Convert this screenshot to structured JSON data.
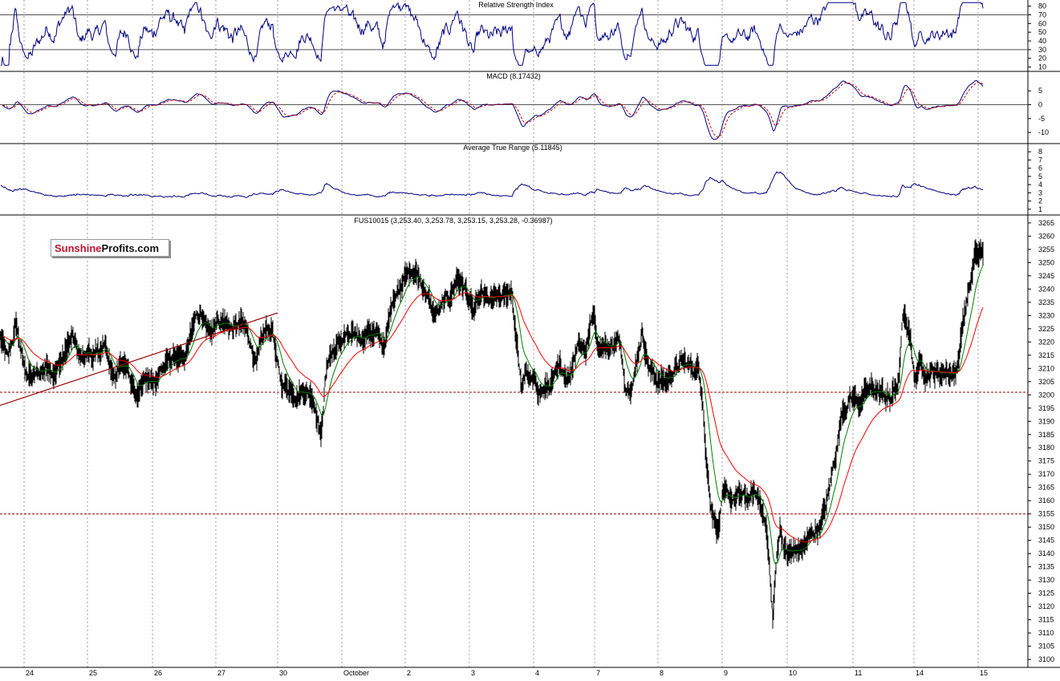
{
  "chart_data": [
    {
      "type": "line",
      "title": "Relative Strength Index",
      "ylim": [
        5,
        87
      ],
      "yticks": [
        10,
        20,
        30,
        40,
        50,
        60,
        70,
        80
      ],
      "reference_lines": [
        70,
        30
      ],
      "series_color": "#000080"
    },
    {
      "type": "line",
      "title": "MACD (8.17432)",
      "ylim": [
        -14,
        12
      ],
      "yticks": [
        -10,
        -5,
        0,
        5
      ],
      "reference_lines": [
        0
      ],
      "series": [
        {
          "color": "#000080",
          "style": "solid"
        },
        {
          "color": "#cc0000",
          "style": "dashed"
        }
      ]
    },
    {
      "type": "line",
      "title": "Average True Range (5.11845)",
      "ylim": [
        0.3,
        9
      ],
      "yticks": [
        1,
        2,
        3,
        4,
        5,
        6,
        7,
        8
      ],
      "series_color": "#000080"
    },
    {
      "type": "line",
      "title": "FUS10015 (3,253.40, 3,253.78, 3,253.15, 3,253.28, -0.36987)",
      "ylim": [
        3097,
        3268
      ],
      "yticks": [
        3100,
        3105,
        3110,
        3115,
        3120,
        3125,
        3130,
        3135,
        3140,
        3145,
        3150,
        3155,
        3160,
        3165,
        3170,
        3175,
        3180,
        3185,
        3190,
        3195,
        3200,
        3205,
        3210,
        3215,
        3220,
        3225,
        3230,
        3235,
        3240,
        3245,
        3250,
        3255,
        3260,
        3265
      ],
      "x_ticks": [
        "24",
        "25",
        "26",
        "27",
        "30",
        "October",
        "2",
        "3",
        "4",
        "7",
        "8",
        "9",
        "10",
        "11",
        "14",
        "15"
      ],
      "price_anchors": [
        [
          0,
          3222
        ],
        [
          10,
          3212
        ],
        [
          20,
          3226
        ],
        [
          30,
          3210
        ],
        [
          40,
          3206
        ],
        [
          50,
          3208
        ],
        [
          60,
          3212
        ],
        [
          70,
          3210
        ],
        [
          80,
          3215
        ],
        [
          90,
          3222
        ],
        [
          100,
          3212
        ],
        [
          110,
          3216
        ],
        [
          120,
          3214
        ],
        [
          130,
          3218
        ],
        [
          140,
          3208
        ],
        [
          150,
          3210
        ],
        [
          160,
          3212
        ],
        [
          170,
          3200
        ],
        [
          180,
          3206
        ],
        [
          190,
          3204
        ],
        [
          200,
          3210
        ],
        [
          210,
          3212
        ],
        [
          220,
          3215
        ],
        [
          230,
          3210
        ],
        [
          240,
          3225
        ],
        [
          250,
          3230
        ],
        [
          260,
          3222
        ],
        [
          270,
          3230
        ],
        [
          280,
          3228
        ],
        [
          290,
          3225
        ],
        [
          300,
          3226
        ],
        [
          310,
          3222
        ],
        [
          320,
          3212
        ],
        [
          330,
          3222
        ],
        [
          340,
          3225
        ],
        [
          345,
          3212
        ],
        [
          350,
          3204
        ],
        [
          360,
          3203
        ],
        [
          370,
          3202
        ],
        [
          380,
          3203
        ],
        [
          390,
          3200
        ],
        [
          397,
          3192
        ],
        [
          400,
          3185
        ],
        [
          405,
          3205
        ],
        [
          410,
          3215
        ],
        [
          420,
          3218
        ],
        [
          430,
          3222
        ],
        [
          440,
          3220
        ],
        [
          450,
          3222
        ],
        [
          460,
          3225
        ],
        [
          470,
          3222
        ],
        [
          480,
          3218
        ],
        [
          490,
          3238
        ],
        [
          500,
          3242
        ],
        [
          505,
          3250
        ],
        [
          510,
          3246
        ],
        [
          520,
          3245
        ],
        [
          530,
          3240
        ],
        [
          540,
          3230
        ],
        [
          550,
          3232
        ],
        [
          560,
          3236
        ],
        [
          570,
          3245
        ],
        [
          580,
          3240
        ],
        [
          590,
          3230
        ],
        [
          600,
          3236
        ],
        [
          610,
          3234
        ],
        [
          620,
          3235
        ],
        [
          630,
          3236
        ],
        [
          638,
          3240
        ],
        [
          642,
          3225
        ],
        [
          645,
          3218
        ],
        [
          650,
          3200
        ],
        [
          655,
          3210
        ],
        [
          660,
          3205
        ],
        [
          670,
          3202
        ],
        [
          680,
          3202
        ],
        [
          690,
          3205
        ],
        [
          700,
          3208
        ],
        [
          710,
          3208
        ],
        [
          720,
          3222
        ],
        [
          730,
          3218
        ],
        [
          740,
          3232
        ],
        [
          745,
          3220
        ],
        [
          750,
          3220
        ],
        [
          760,
          3218
        ],
        [
          770,
          3222
        ],
        [
          780,
          3204
        ],
        [
          790,
          3208
        ],
        [
          800,
          3225
        ],
        [
          810,
          3210
        ],
        [
          820,
          3206
        ],
        [
          830,
          3205
        ],
        [
          840,
          3210
        ],
        [
          850,
          3212
        ],
        [
          860,
          3210
        ],
        [
          870,
          3210
        ],
        [
          876,
          3200
        ],
        [
          880,
          3178
        ],
        [
          885,
          3162
        ],
        [
          890,
          3155
        ],
        [
          895,
          3150
        ],
        [
          900,
          3160
        ],
        [
          910,
          3160
        ],
        [
          920,
          3161
        ],
        [
          930,
          3160
        ],
        [
          940,
          3162
        ],
        [
          950,
          3158
        ],
        [
          955,
          3150
        ],
        [
          960,
          3130
        ],
        [
          963,
          3115
        ],
        [
          968,
          3138
        ],
        [
          972,
          3150
        ],
        [
          980,
          3140
        ],
        [
          990,
          3140
        ],
        [
          1000,
          3142
        ],
        [
          1010,
          3146
        ],
        [
          1020,
          3150
        ],
        [
          1030,
          3158
        ],
        [
          1040,
          3175
        ],
        [
          1050,
          3195
        ],
        [
          1060,
          3200
        ],
        [
          1070,
          3198
        ],
        [
          1080,
          3200
        ],
        [
          1090,
          3202
        ],
        [
          1100,
          3200
        ],
        [
          1110,
          3198
        ],
        [
          1120,
          3205
        ],
        [
          1125,
          3228
        ],
        [
          1130,
          3225
        ],
        [
          1135,
          3222
        ],
        [
          1140,
          3205
        ],
        [
          1145,
          3212
        ],
        [
          1150,
          3210
        ],
        [
          1160,
          3210
        ],
        [
          1170,
          3208
        ],
        [
          1180,
          3210
        ],
        [
          1190,
          3208
        ],
        [
          1195,
          3215
        ],
        [
          1200,
          3228
        ],
        [
          1205,
          3235
        ],
        [
          1210,
          3242
        ],
        [
          1215,
          3252
        ],
        [
          1218,
          3253
        ]
      ],
      "moving_averages": [
        {
          "color": "#008000",
          "period": "short"
        },
        {
          "color": "#ff0000",
          "period": "long"
        }
      ],
      "trendline": {
        "from": [
          0,
          3196
        ],
        "to": [
          346,
          3231
        ],
        "color": "#990000"
      },
      "horizontal_levels": [
        3201,
        3155
      ],
      "level_color": "#990000",
      "logo": {
        "red": "Sunshine",
        "black": "Profits.com"
      }
    }
  ]
}
